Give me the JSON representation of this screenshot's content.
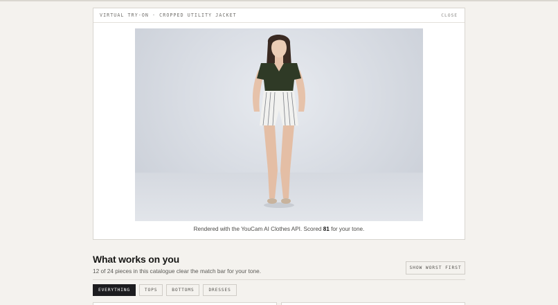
{
  "modal": {
    "title": "VIRTUAL TRY-ON · CROPPED UTILITY JACKET",
    "close_label": "CLOSE",
    "caption_prefix": "Rendered with the YouCam AI Clothes API. Scored ",
    "score": "81",
    "caption_suffix": " for your tone."
  },
  "section": {
    "title": "What works on you",
    "subtitle": "12 of 24 pieces in this catalogue clear the match bar for your tone.",
    "worst_button": "SHOW WORST FIRST"
  },
  "filters": [
    "EVERYTHING",
    "TOPS",
    "BOTTOMS",
    "DRESSES"
  ],
  "colors": {
    "page_bg": "#f4f2ee",
    "active_chip": "#1c1c1f",
    "top_garment": "#2f3a26"
  }
}
